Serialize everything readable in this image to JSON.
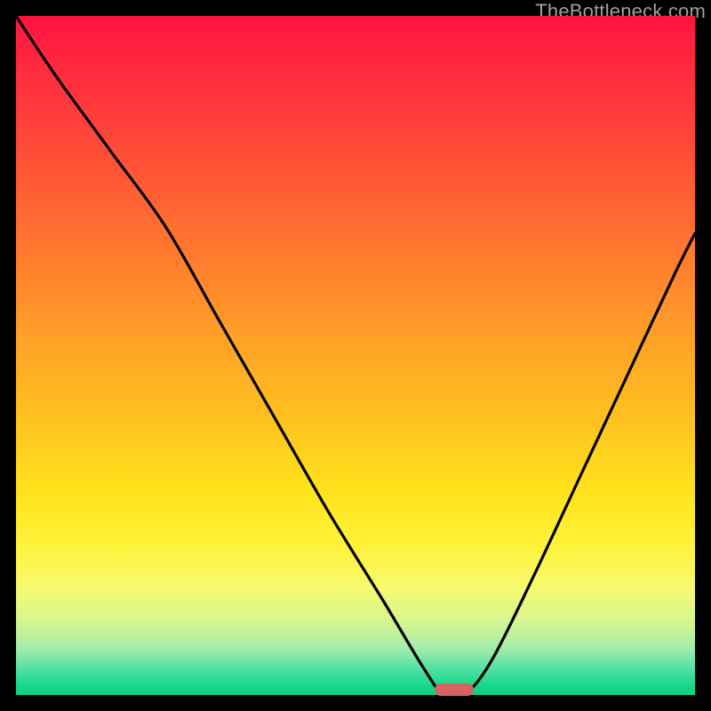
{
  "watermark": "TheBottleneck.com",
  "colors": {
    "curve": "#000000",
    "marker": "#d96063",
    "background": "#000000"
  },
  "chart_data": {
    "type": "line",
    "title": "",
    "xlabel": "",
    "ylabel": "",
    "xlim": [
      0,
      100
    ],
    "ylim": [
      0,
      100
    ],
    "series": [
      {
        "name": "bottleneck-curve",
        "x": [
          0,
          6,
          14,
          22,
          30,
          38,
          46,
          54,
          60,
          63,
          66,
          70,
          76,
          83,
          90,
          97,
          100
        ],
        "values": [
          100,
          91,
          80,
          69,
          55,
          41,
          27,
          14,
          4,
          0,
          0,
          5,
          17,
          32,
          47,
          62,
          68
        ]
      }
    ],
    "marker": {
      "x": 64.5,
      "y": 0.8,
      "width_pct": 5.8,
      "height_pct": 1.8
    },
    "gradient_stops": [
      {
        "pos": 0.0,
        "color": "#ff1440"
      },
      {
        "pos": 0.35,
        "color": "#ff7a2e"
      },
      {
        "pos": 0.7,
        "color": "#ffe31b"
      },
      {
        "pos": 0.9,
        "color": "#a6edab"
      },
      {
        "pos": 1.0,
        "color": "#0bcf7e"
      }
    ]
  }
}
